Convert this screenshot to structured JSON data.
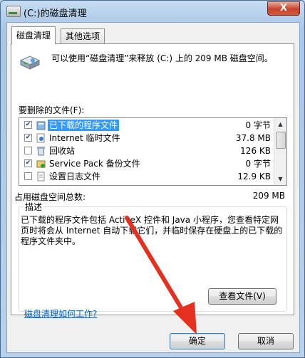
{
  "window": {
    "title": "(C:)的磁盘清理",
    "close_label": "X"
  },
  "tabs": [
    {
      "label": "磁盘清理"
    },
    {
      "label": "其他选项"
    }
  ],
  "intro": "可以使用“磁盘清理”来释放 (C:) 上的 209 MB 磁盘空间。",
  "list": {
    "label": "要删除的文件(F):",
    "items": [
      {
        "name": "已下载的程序文件",
        "size": "0 字节",
        "checked": true
      },
      {
        "name": "Internet 临时文件",
        "size": "37.8 MB",
        "checked": true
      },
      {
        "name": "回收站",
        "size": "126 KB",
        "checked": false
      },
      {
        "name": "Service Pack 备份文件",
        "size": "0 字节",
        "checked": true
      },
      {
        "name": "设置日志文件",
        "size": "12.9 KB",
        "checked": false
      }
    ]
  },
  "total": {
    "label": "占用磁盘空间总数:",
    "value": "209 MB"
  },
  "description": {
    "title": "描述",
    "text": "已下载的程序文件包括 ActiveX 控件和 Java 小程序，您查看特定网页时将会从 Internet 自动下载它们，并临时保存在硬盘上的已下载的程序文件夹中。"
  },
  "view_files_button": "查看文件(V)",
  "help_link": "磁盘清理如何工作?",
  "ok_button": "确定",
  "cancel_button": "取消",
  "colors": {
    "selection": "#3399ff",
    "link": "#0066cc",
    "annotation_arrow": "#e53020"
  }
}
